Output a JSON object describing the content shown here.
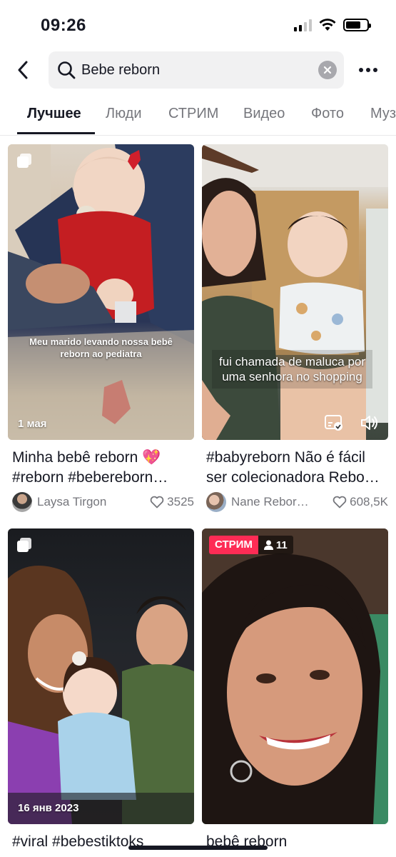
{
  "status": {
    "time": "09:26"
  },
  "search": {
    "query": "Bebe reborn"
  },
  "tabs": [
    {
      "label": "Лучшее"
    },
    {
      "label": "Люди"
    },
    {
      "label": "СТРИМ"
    },
    {
      "label": "Видео"
    },
    {
      "label": "Фото"
    },
    {
      "label": "Муз"
    }
  ],
  "results": [
    {
      "type": "photo",
      "date": "1 мая",
      "caption": "Meu marido levando nossa bebê reborn ao pediatra",
      "title_line1": "Minha bebê reborn 💖",
      "title_line2": "#reborn #bebereborn…",
      "author": "Laysa Tirgon",
      "likes": "3525"
    },
    {
      "type": "video",
      "caption": "fui chamada de maluca por uma senhora no shopping",
      "title_line1": "#babyreborn Não é fácil",
      "title_line2": "ser colecionadora Rebo…",
      "author": "Nane Rebor…",
      "likes": "608,5K"
    },
    {
      "type": "photo",
      "date": "16 янв 2023",
      "title_line1": "#viral #bebestiktoks"
    },
    {
      "type": "live",
      "live_label": "СТРИМ",
      "viewers": "11",
      "title_line1": "bebê reborn"
    }
  ],
  "colors": {
    "accent": "#fe2c55",
    "text": "#161823",
    "muted": "#75767c"
  }
}
